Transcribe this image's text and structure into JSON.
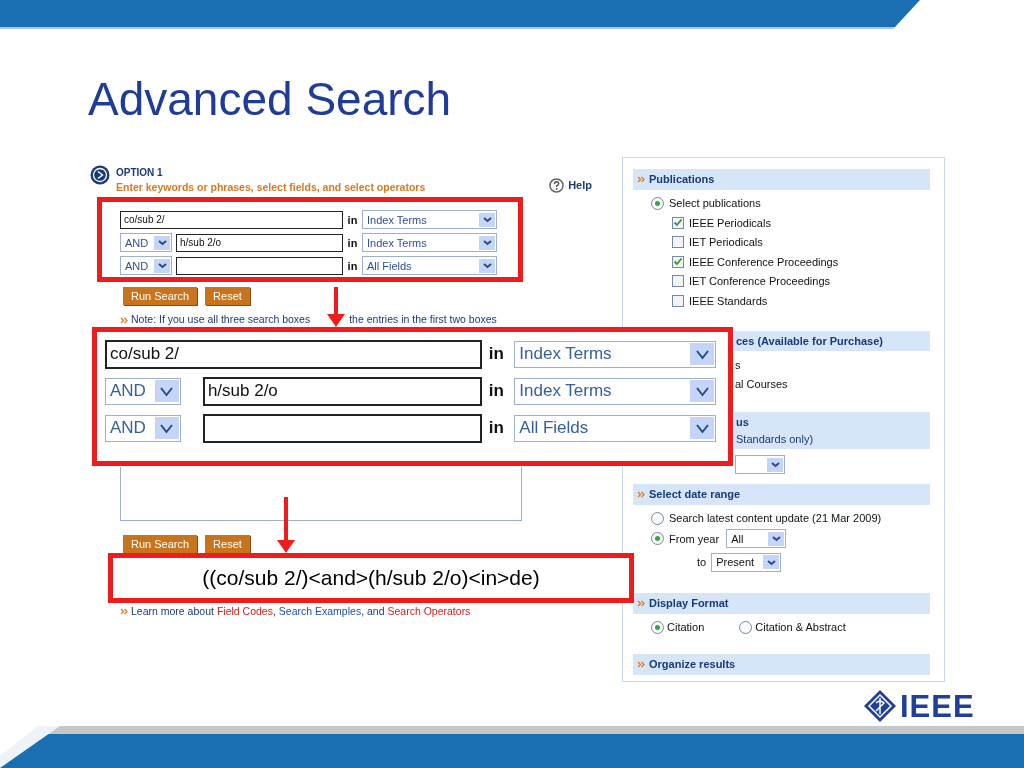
{
  "slide_title": "Advanced Search",
  "option": {
    "label": "OPTION 1",
    "instruction": "Enter keywords or phrases, select fields, and select operators",
    "help": "Help"
  },
  "search_rows": [
    {
      "kind": "first",
      "term": "co/sub 2/",
      "in": "in",
      "field": "Index Terms"
    },
    {
      "kind": "operator",
      "operator": "AND",
      "term": "h/sub 2/o",
      "in": "in",
      "field": "Index Terms"
    },
    {
      "kind": "operator",
      "operator": "AND",
      "in": "in",
      "field": "All Fields"
    }
  ],
  "buttons": [
    "Run Search",
    "Reset"
  ],
  "note": [
    "Note: If you use all three search boxes",
    "the entries in the first two boxes"
  ],
  "buttons_lower": [
    "Run Search",
    "Reset"
  ],
  "learn_more": [
    {
      "kind": "text",
      "text": "Learn more about"
    },
    {
      "kind": "link",
      "text": "Field Codes",
      "color": "#d42020"
    },
    {
      "kind": "text",
      "text": ","
    },
    {
      "kind": "link",
      "text": "Search Examples",
      "color": "#1f4fa8"
    },
    {
      "kind": "text",
      "text": ", and"
    },
    {
      "kind": "link",
      "text": "Search Operators",
      "color": "#d42020"
    }
  ],
  "sidebar": {
    "sections": [
      {
        "kind": "full",
        "heading": "Publications",
        "items": [
          {
            "kind": "radio",
            "label": "Select publications",
            "selected": true
          },
          {
            "kind": "checkbox",
            "label": "IEEE Periodicals",
            "checked": true
          },
          {
            "kind": "checkbox",
            "label": "IET Periodicals",
            "checked": false
          },
          {
            "kind": "checkbox",
            "label": "IEEE Conference Proceedings",
            "checked": true
          },
          {
            "kind": "checkbox",
            "label": "IET Conference Proceedings",
            "checked": false
          },
          {
            "kind": "checkbox",
            "label": "IEEE Standards",
            "checked": false
          }
        ]
      },
      {
        "kind": "covered",
        "heading": "**ces** (Available for Purchase)",
        "items": [
          {
            "kind": "text",
            "label": "s"
          },
          {
            "kind": "text",
            "label": "al Courses"
          }
        ]
      },
      {
        "kind": "covered",
        "heading": "us",
        "subheading": "Standards only)",
        "items": [
          {
            "kind": "select"
          }
        ]
      },
      {
        "kind": "full",
        "heading": "Select date range",
        "items": [
          {
            "kind": "radio",
            "label": "Search latest content update (21 Mar 2009)",
            "selected": false
          },
          {
            "kind": "radio",
            "label": "From year",
            "selected": true,
            "select": "All"
          },
          {
            "kind": "select_row",
            "label": "to",
            "select": "Present"
          }
        ]
      },
      {
        "kind": "full",
        "heading": "Display Format",
        "items": [
          {
            "kind": "radio_group",
            "options": [
              {
                "label": "Citation",
                "selected": true
              },
              {
                "label": "Citation & Abstract",
                "selected": false
              }
            ]
          }
        ]
      },
      {
        "kind": "full",
        "heading": "Organize results"
      }
    ]
  },
  "zoom_callout": {
    "rows": [
      {
        "kind": "first",
        "term": "co/sub 2/",
        "in": "in",
        "field": "Index Terms"
      },
      {
        "kind": "operator",
        "operator": "AND",
        "term": "h/sub 2/o",
        "in": "in",
        "field": "Index Terms"
      },
      {
        "kind": "operator",
        "operator": "AND",
        "in": "in",
        "field": "All Fields"
      }
    ]
  },
  "query_callout": "((co/sub 2/)<and>(h/sub 2/o)<in>de)",
  "logo": "IEEE"
}
